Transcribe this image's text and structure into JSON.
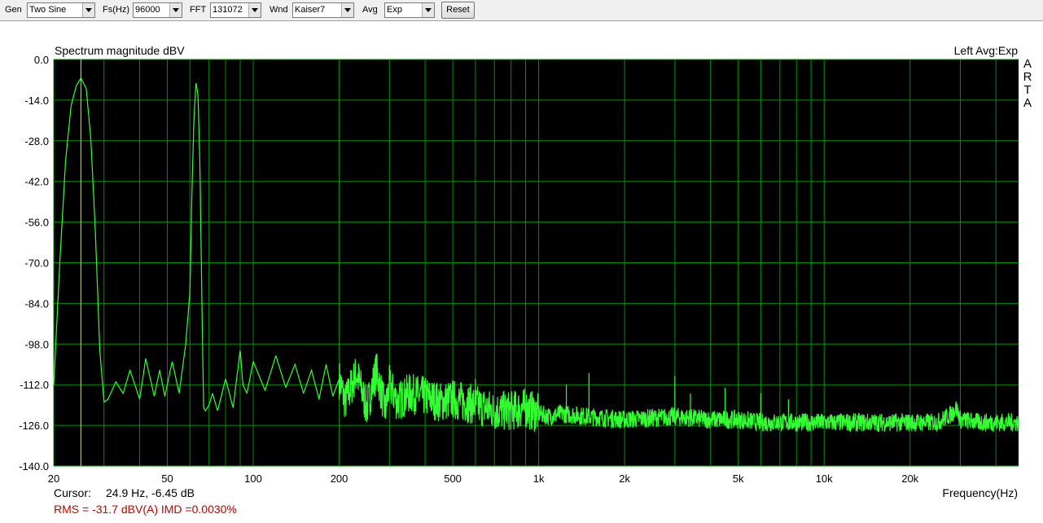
{
  "toolbar": {
    "gen_label": "Gen",
    "gen_value": "Two Sine",
    "fs_label": "Fs(Hz)",
    "fs_value": "96000",
    "fft_label": "FFT",
    "fft_value": "131072",
    "wnd_label": "Wnd",
    "wnd_value": "Kaiser7",
    "avg_label": "Avg",
    "avg_value": "Exp",
    "reset_label": "Reset"
  },
  "plot": {
    "channel_info": "Left  Avg:Exp",
    "watermark": "ARTA",
    "cursor_label": "Cursor:",
    "cursor_value": "24.9 Hz, -6.45 dB",
    "rms_text": "RMS =  -31.7 dBV(A)   IMD =0.0030%"
  },
  "colors": {
    "background": "#000000",
    "grid": "#008f00",
    "trace": "#33ff33",
    "cursor": "#c8ff00",
    "rms_text": "#c00000"
  },
  "chart_data": {
    "type": "line",
    "title": "Spectrum magnitude dBV",
    "xlabel": "Frequency(Hz)",
    "ylabel": "",
    "x_scale": "log",
    "xlim": [
      20,
      48000
    ],
    "ylim": [
      -140,
      0
    ],
    "y_ticks": [
      "0.0",
      "-14.0",
      "-28.0",
      "-42.0",
      "-56.0",
      "-70.0",
      "-84.0",
      "-98.0",
      "-112.0",
      "-126.0",
      "-140.0"
    ],
    "x_tick_labels": [
      {
        "f": 20,
        "label": "20"
      },
      {
        "f": 50,
        "label": "50"
      },
      {
        "f": 100,
        "label": "100"
      },
      {
        "f": 200,
        "label": "200"
      },
      {
        "f": 500,
        "label": "500"
      },
      {
        "f": 1000,
        "label": "1k"
      },
      {
        "f": 2000,
        "label": "2k"
      },
      {
        "f": 5000,
        "label": "5k"
      },
      {
        "f": 10000,
        "label": "10k"
      },
      {
        "f": 20000,
        "label": "20k"
      }
    ],
    "grid": true,
    "cursor_freq": 24.9,
    "series": [
      {
        "x": [
          20,
          21,
          22,
          23,
          24,
          24.9,
          26,
          27,
          28,
          29,
          30,
          31,
          33,
          35,
          37,
          40,
          42,
          45,
          47,
          49,
          52,
          55,
          58,
          60,
          61,
          62,
          63,
          64,
          65,
          66,
          67,
          68,
          69,
          70,
          72,
          75,
          80,
          85,
          90,
          92,
          95,
          100,
          110,
          120,
          130,
          140,
          150,
          160,
          170,
          180,
          190,
          200,
          210,
          230,
          250,
          270,
          290,
          300,
          320,
          350,
          400,
          450,
          500,
          600,
          700,
          800,
          900,
          1000,
          1100,
          1200,
          1500,
          2000,
          3000,
          4000,
          5000,
          6000,
          7000,
          8000,
          10000,
          12000,
          15000,
          20000,
          25000,
          28000,
          29000,
          30000,
          35000,
          40000,
          48000
        ],
        "y": [
          -112,
          -70,
          -35,
          -16,
          -9,
          -6.45,
          -10,
          -28,
          -60,
          -100,
          -118,
          -117,
          -111,
          -115,
          -107,
          -117,
          -103,
          -116,
          -107,
          -116,
          -104,
          -115,
          -98,
          -80,
          -45,
          -20,
          -8,
          -12,
          -35,
          -80,
          -120,
          -121,
          -120,
          -119,
          -115,
          -121,
          -110,
          -120,
          -100,
          -112,
          -115,
          -104,
          -114,
          -102,
          -113,
          -105,
          -115,
          -107,
          -117,
          -105,
          -116,
          -110,
          -118,
          -108,
          -120,
          -107,
          -121,
          -112,
          -118,
          -115,
          -116,
          -118,
          -117,
          -119,
          -121,
          -121,
          -120,
          -122,
          -123,
          -122,
          -123,
          -124,
          -123,
          -124,
          -124,
          -125,
          -125,
          -125,
          -125,
          -125,
          -125,
          -125,
          -125,
          -122,
          -120,
          -124,
          -125,
          -125,
          -125
        ]
      }
    ],
    "spurs": [
      {
        "f": 300,
        "y": -111
      },
      {
        "f": 600,
        "y": -110
      },
      {
        "f": 1250,
        "y": -112
      },
      {
        "f": 1500,
        "y": -108
      },
      {
        "f": 3000,
        "y": -109
      },
      {
        "f": 3400,
        "y": -115
      },
      {
        "f": 4500,
        "y": -113
      },
      {
        "f": 6000,
        "y": -115
      },
      {
        "f": 7500,
        "y": -117
      }
    ]
  }
}
